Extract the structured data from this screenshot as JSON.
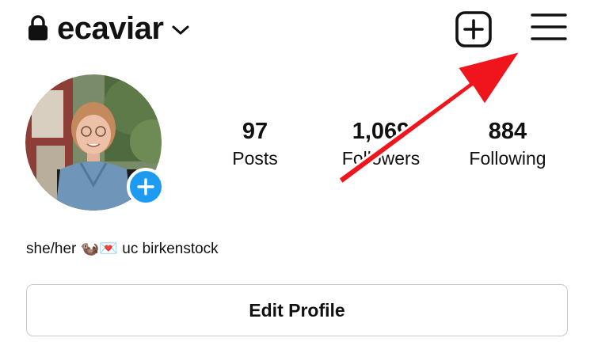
{
  "header": {
    "lock_icon": "lock-icon",
    "username": "ecaviar",
    "dropdown_icon": "chevron-down-icon",
    "new_post_icon": "plus-square-icon",
    "menu_icon": "hamburger-menu-icon"
  },
  "profile": {
    "avatar_badge_icon": "plus-icon",
    "stats": [
      {
        "count": "97",
        "label": "Posts"
      },
      {
        "count": "1,069",
        "label": "Followers"
      },
      {
        "count": "884",
        "label": "Following"
      }
    ],
    "bio": "she/her 🦦💌 uc birkenstock",
    "edit_profile_label": "Edit Profile"
  },
  "colors": {
    "text": "#111111",
    "badge_blue": "#1d9bf0",
    "annotation_red": "#f0141c",
    "border": "#c9c9c9"
  }
}
